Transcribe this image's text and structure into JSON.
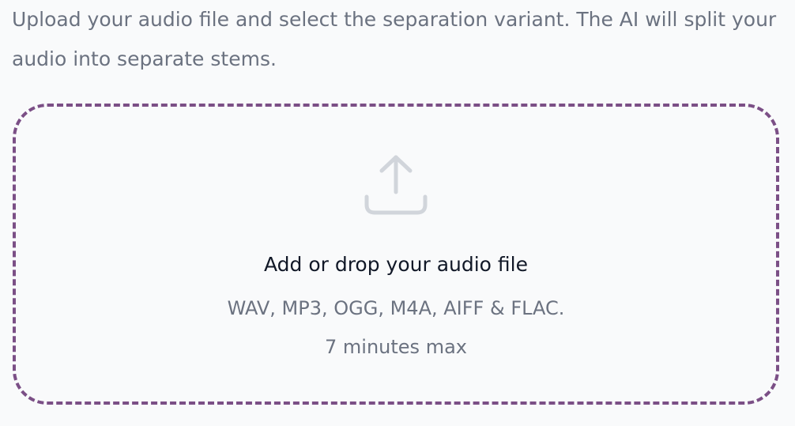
{
  "intro": {
    "text": "Upload your audio file and select the separation variant. The AI will split your audio into separate stems."
  },
  "dropzone": {
    "icon": "upload-icon",
    "title": "Add or drop your audio file",
    "formats": "WAV, MP3, OGG, M4A, AIFF & FLAC.",
    "limit": "7 minutes max",
    "border_color": "#7b4f86"
  }
}
